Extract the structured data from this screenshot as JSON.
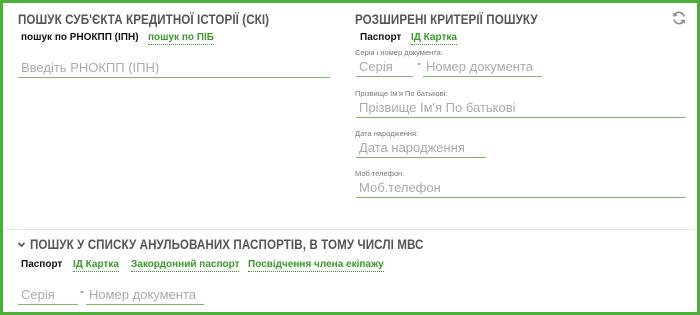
{
  "search_subject": {
    "title": "ПОШУК СУБ'ЄКТА КРЕДИТНОЇ ІСТОРІЇ (СКІ)",
    "tabs": [
      {
        "label": "пошук по РНОКПП (ІПН)",
        "active": true
      },
      {
        "label": "пошук по ПІБ",
        "active": false
      }
    ],
    "rnokpp_placeholder": "Введіть РНОКПП (ІПН)"
  },
  "extended": {
    "title": "РОЗШИРЕНІ КРИТЕРІЇ ПОШУКУ",
    "refresh_icon": "refresh-icon",
    "tabs": [
      {
        "label": "Паспорт",
        "active": true
      },
      {
        "label": "ІД Картка",
        "active": false
      }
    ],
    "doc_label": "Серія і номер документа:",
    "series_placeholder": "Серія",
    "number_placeholder": "Номер документа",
    "dash": "-",
    "fio_label": "Прізвище Ім'я По батькові:",
    "fio_placeholder": "Прізвище Ім'я По батькові",
    "birth_label": "Дата народження:",
    "birth_placeholder": "Дата народження",
    "phone_label": "Моб.телефон:",
    "phone_placeholder": "Моб.телефон"
  },
  "annulled": {
    "title": "ПОШУК У СПИСКУ АНУЛЬОВАНИХ ПАСПОРТІВ, В ТОМУ ЧИСЛІ МВС",
    "chevron_icon": "chevron-down-icon",
    "tabs": [
      {
        "label": "Паспорт",
        "active": true
      },
      {
        "label": "ІД Картка",
        "active": false
      },
      {
        "label": "Закордонний паспорт",
        "active": false
      },
      {
        "label": "Посвідчення члена екіпажу",
        "active": false
      }
    ],
    "series_placeholder": "Серія",
    "number_placeholder": "Номер документа",
    "dash": "-"
  },
  "colors": {
    "border": "#4caf3a",
    "accent": "#3a9a2a",
    "underline": "#7ab86a"
  }
}
